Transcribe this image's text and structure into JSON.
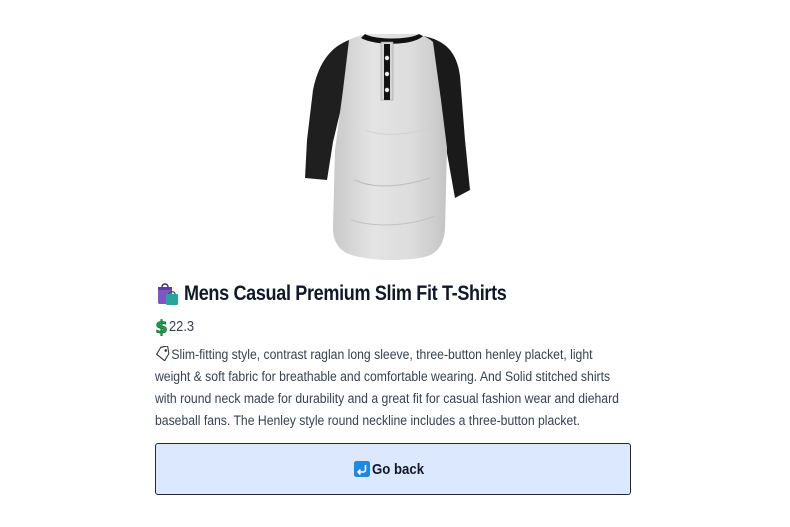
{
  "product": {
    "image_alt": "Mens Casual Premium Slim Fit T-Shirts",
    "title_icon": "shopping-bags-icon",
    "title": "Mens Casual Premium Slim Fit T-Shirts",
    "price_icon": "dollar-sign-icon",
    "price": "22.3",
    "description_icon": "label-tag-icon",
    "description": "Slim-fitting style, contrast raglan long sleeve, three-button henley placket, light weight & soft fabric for breathable and comfortable wearing. And Solid stitched shirts with round neck made for durability and a great fit for casual fashion wear and diehard baseball fans. The Henley style round neckline includes a three-button placket."
  },
  "back_button": {
    "icon": "return-arrow-icon",
    "label": "Go back"
  },
  "colors": {
    "button_background": "#dbe8fd",
    "button_border": "#1f2937",
    "price_icon_color": "#16a34a",
    "title_icon_color": "#7e57c2"
  }
}
